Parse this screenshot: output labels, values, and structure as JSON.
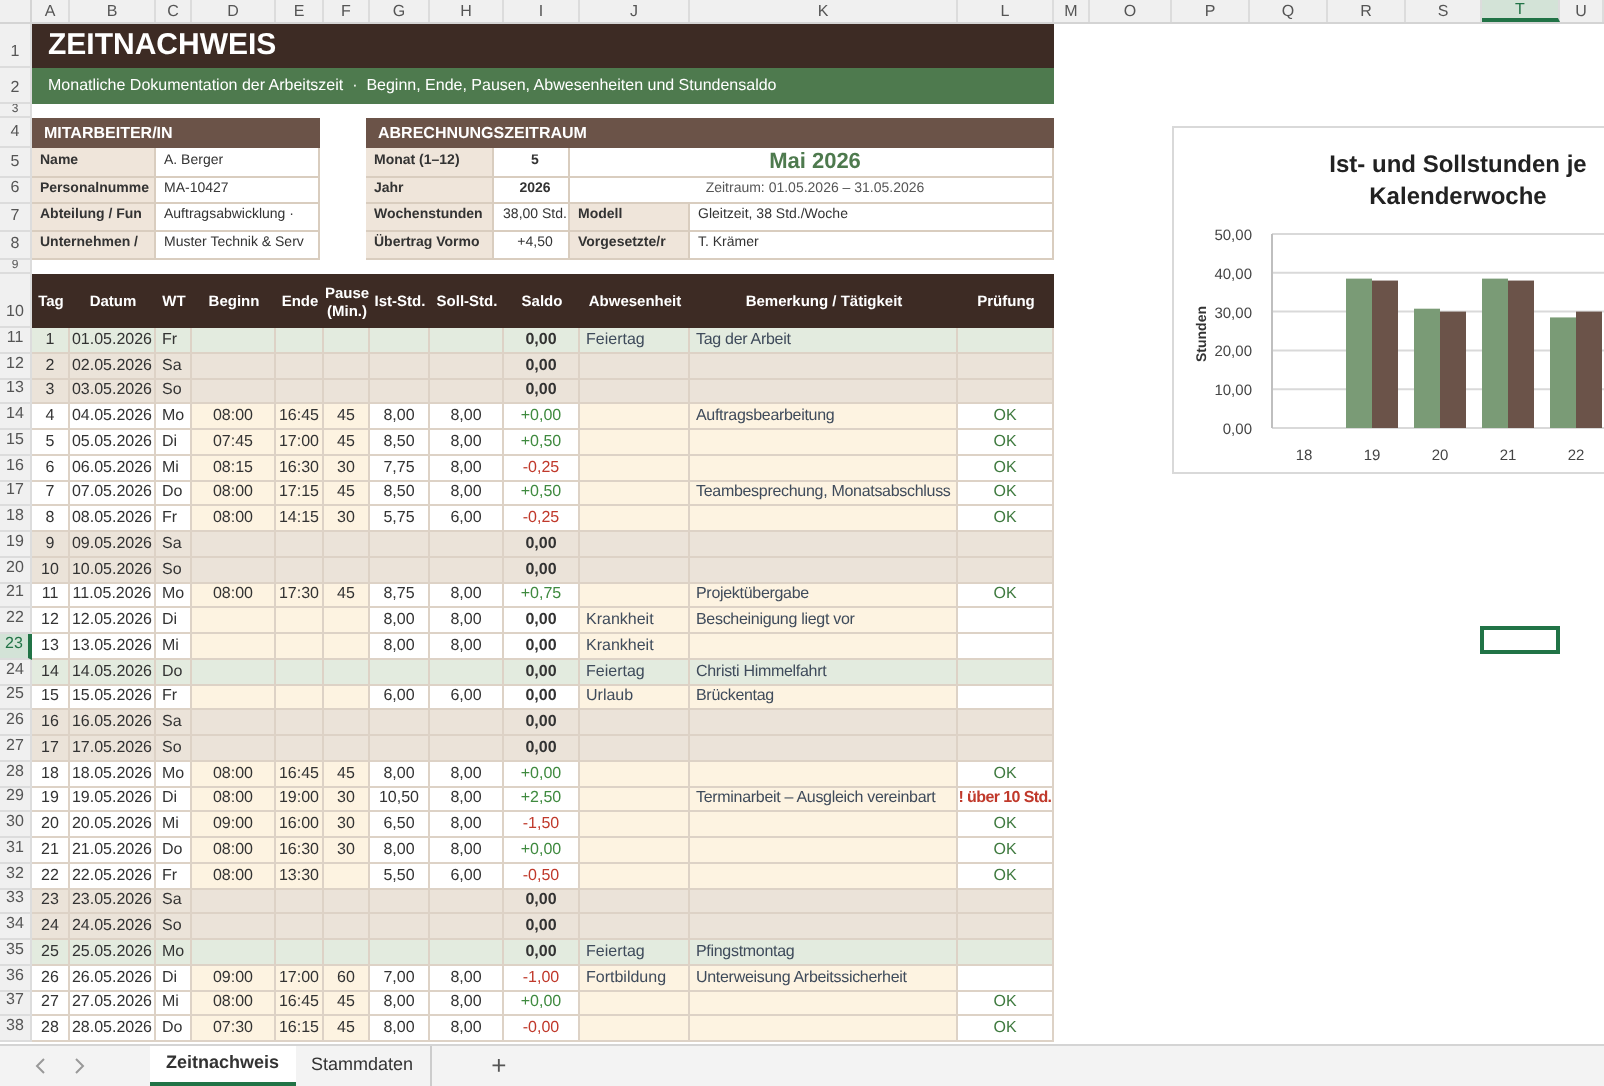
{
  "column_headers": [
    {
      "label": "A",
      "selected": false
    },
    {
      "label": "B",
      "selected": false
    },
    {
      "label": "C",
      "selected": false
    },
    {
      "label": "D",
      "selected": false
    },
    {
      "label": "E",
      "selected": false
    },
    {
      "label": "F",
      "selected": false
    },
    {
      "label": "G",
      "selected": false
    },
    {
      "label": "H",
      "selected": false
    },
    {
      "label": "I",
      "selected": false
    },
    {
      "label": "J",
      "selected": false
    },
    {
      "label": "K",
      "selected": false
    },
    {
      "label": "L",
      "selected": false
    },
    {
      "label": "M",
      "selected": false
    },
    {
      "label": "O",
      "selected": false
    },
    {
      "label": "P",
      "selected": false
    },
    {
      "label": "Q",
      "selected": false
    },
    {
      "label": "R",
      "selected": false
    },
    {
      "label": "S",
      "selected": false
    },
    {
      "label": "T",
      "selected": true
    },
    {
      "label": "U",
      "selected": false
    }
  ],
  "row_headers": [
    {
      "label": "1",
      "selected": false
    },
    {
      "label": "2",
      "selected": false
    },
    {
      "label": "3",
      "selected": false
    },
    {
      "label": "4",
      "selected": false
    },
    {
      "label": "5",
      "selected": false
    },
    {
      "label": "6",
      "selected": false
    },
    {
      "label": "7",
      "selected": false
    },
    {
      "label": "8",
      "selected": false
    },
    {
      "label": "9",
      "selected": false
    },
    {
      "label": "10",
      "selected": false
    },
    {
      "label": "11",
      "selected": false
    },
    {
      "label": "12",
      "selected": false
    },
    {
      "label": "13",
      "selected": false
    },
    {
      "label": "14",
      "selected": false
    },
    {
      "label": "15",
      "selected": false
    },
    {
      "label": "16",
      "selected": false
    },
    {
      "label": "17",
      "selected": false
    },
    {
      "label": "18",
      "selected": false
    },
    {
      "label": "19",
      "selected": false
    },
    {
      "label": "20",
      "selected": false
    },
    {
      "label": "21",
      "selected": false
    },
    {
      "label": "22",
      "selected": false
    },
    {
      "label": "23",
      "selected": true
    },
    {
      "label": "24",
      "selected": false
    },
    {
      "label": "25",
      "selected": false
    },
    {
      "label": "26",
      "selected": false
    },
    {
      "label": "27",
      "selected": false
    },
    {
      "label": "28",
      "selected": false
    },
    {
      "label": "29",
      "selected": false
    },
    {
      "label": "30",
      "selected": false
    },
    {
      "label": "31",
      "selected": false
    },
    {
      "label": "32",
      "selected": false
    },
    {
      "label": "33",
      "selected": false
    },
    {
      "label": "34",
      "selected": false
    },
    {
      "label": "35",
      "selected": false
    },
    {
      "label": "36",
      "selected": false
    },
    {
      "label": "37",
      "selected": false
    },
    {
      "label": "38",
      "selected": false
    }
  ],
  "title": "ZEITNACHWEIS",
  "subtitle": "Monatliche Dokumentation der Arbeitszeit  ·  Beginn, Ende, Pausen, Abwesenheiten und Stundensaldo",
  "employee": {
    "heading": "MITARBEITER/IN",
    "fields": [
      {
        "label": "Name",
        "value": "A. Berger"
      },
      {
        "label": "Personalnumme",
        "value": "MA-10427"
      },
      {
        "label": "Abteilung / Fun",
        "value": "Auftragsabwicklung ·"
      },
      {
        "label": "Unternehmen /",
        "value": "Muster Technik & Serv"
      }
    ]
  },
  "period": {
    "heading": "ABRECHNUNGSZEITRAUM",
    "month_label": "Monat (1–12)",
    "month": "5",
    "month_name": "Mai 2026",
    "year_label": "Jahr",
    "year": "2026",
    "range": "Zeitraum: 01.05.2026 – 31.05.2026",
    "weekly_label": "Wochenstunden",
    "weekly": "38,00 Std.",
    "model_label": "Modell",
    "model": "Gleitzeit, 38 Std./Woche",
    "carry_label": "Übertrag Vormo",
    "carry": "+4,50",
    "supervisor_label": "Vorgesetzte/r",
    "supervisor": "T. Krämer"
  },
  "table": {
    "columns": [
      "Tag",
      "Datum",
      "WT",
      "Beginn",
      "Ende",
      "Pause (Min.)",
      "Ist-Std.",
      "Soll-Std.",
      "Saldo",
      "Abwesenheit",
      "Bemerkung / Tätigkeit",
      "Prüfung"
    ],
    "rows": [
      {
        "kind": "holiday",
        "tag": "1",
        "datum": "01.05.2026",
        "wt": "Fr",
        "saldo": {
          "text": "0,00",
          "color": "#333333",
          "bold": true
        },
        "abwesenheit": "Feiertag",
        "bemerkung": "Tag der Arbeit"
      },
      {
        "kind": "weekend",
        "tag": "2",
        "datum": "02.05.2026",
        "wt": "Sa",
        "saldo": {
          "text": "0,00",
          "color": "#333333",
          "bold": true
        }
      },
      {
        "kind": "weekend",
        "tag": "3",
        "datum": "03.05.2026",
        "wt": "So",
        "saldo": {
          "text": "0,00",
          "color": "#333333",
          "bold": true
        }
      },
      {
        "kind": "work",
        "tag": "4",
        "datum": "04.05.2026",
        "wt": "Mo",
        "beginn": "08:00",
        "ende": "16:45",
        "pause": "45",
        "ist": "8,00",
        "soll": "8,00",
        "saldo": {
          "text": "+0,00",
          "color": "#3f8a3f",
          "bold": false
        },
        "bemerkung": "Auftragsbearbeitung",
        "pruefung": {
          "text": "OK",
          "kind": "ok"
        }
      },
      {
        "kind": "work",
        "tag": "5",
        "datum": "05.05.2026",
        "wt": "Di",
        "beginn": "07:45",
        "ende": "17:00",
        "pause": "45",
        "ist": "8,50",
        "soll": "8,00",
        "saldo": {
          "text": "+0,50",
          "color": "#3f8a3f",
          "bold": false
        },
        "pruefung": {
          "text": "OK",
          "kind": "ok"
        }
      },
      {
        "kind": "work",
        "tag": "6",
        "datum": "06.05.2026",
        "wt": "Mi",
        "beginn": "08:15",
        "ende": "16:30",
        "pause": "30",
        "ist": "7,75",
        "soll": "8,00",
        "saldo": {
          "text": "-0,25",
          "color": "#c0392b",
          "bold": false
        },
        "pruefung": {
          "text": "OK",
          "kind": "ok"
        }
      },
      {
        "kind": "work",
        "tag": "7",
        "datum": "07.05.2026",
        "wt": "Do",
        "beginn": "08:00",
        "ende": "17:15",
        "pause": "45",
        "ist": "8,50",
        "soll": "8,00",
        "saldo": {
          "text": "+0,50",
          "color": "#3f8a3f",
          "bold": false
        },
        "bemerkung": "Teambesprechung, Monatsabschluss",
        "pruefung": {
          "text": "OK",
          "kind": "ok"
        }
      },
      {
        "kind": "work",
        "tag": "8",
        "datum": "08.05.2026",
        "wt": "Fr",
        "beginn": "08:00",
        "ende": "14:15",
        "pause": "30",
        "ist": "5,75",
        "soll": "6,00",
        "saldo": {
          "text": "-0,25",
          "color": "#c0392b",
          "bold": false
        },
        "pruefung": {
          "text": "OK",
          "kind": "ok"
        }
      },
      {
        "kind": "weekend",
        "tag": "9",
        "datum": "09.05.2026",
        "wt": "Sa",
        "saldo": {
          "text": "0,00",
          "color": "#333333",
          "bold": true
        }
      },
      {
        "kind": "weekend",
        "tag": "10",
        "datum": "10.05.2026",
        "wt": "So",
        "saldo": {
          "text": "0,00",
          "color": "#333333",
          "bold": true
        }
      },
      {
        "kind": "work",
        "tag": "11",
        "datum": "11.05.2026",
        "wt": "Mo",
        "beginn": "08:00",
        "ende": "17:30",
        "pause": "45",
        "ist": "8,75",
        "soll": "8,00",
        "saldo": {
          "text": "+0,75",
          "color": "#3f8a3f",
          "bold": false
        },
        "bemerkung": "Projektübergabe",
        "pruefung": {
          "text": "OK",
          "kind": "ok"
        }
      },
      {
        "kind": "work",
        "tag": "12",
        "datum": "12.05.2026",
        "wt": "Di",
        "ist": "8,00",
        "soll": "8,00",
        "saldo": {
          "text": "0,00",
          "color": "#333333",
          "bold": true
        },
        "abwesenheit": "Krankheit",
        "bemerkung": "Bescheinigung liegt vor"
      },
      {
        "kind": "work",
        "tag": "13",
        "datum": "13.05.2026",
        "wt": "Mi",
        "ist": "8,00",
        "soll": "8,00",
        "saldo": {
          "text": "0,00",
          "color": "#333333",
          "bold": true
        },
        "abwesenheit": "Krankheit"
      },
      {
        "kind": "holiday",
        "tag": "14",
        "datum": "14.05.2026",
        "wt": "Do",
        "saldo": {
          "text": "0,00",
          "color": "#333333",
          "bold": true
        },
        "abwesenheit": "Feiertag",
        "bemerkung": "Christi Himmelfahrt"
      },
      {
        "kind": "work",
        "tag": "15",
        "datum": "15.05.2026",
        "wt": "Fr",
        "ist": "6,00",
        "soll": "6,00",
        "saldo": {
          "text": "0,00",
          "color": "#333333",
          "bold": true
        },
        "abwesenheit": "Urlaub",
        "bemerkung": "Brückentag"
      },
      {
        "kind": "weekend",
        "tag": "16",
        "datum": "16.05.2026",
        "wt": "Sa",
        "saldo": {
          "text": "0,00",
          "color": "#333333",
          "bold": true
        }
      },
      {
        "kind": "weekend",
        "tag": "17",
        "datum": "17.05.2026",
        "wt": "So",
        "saldo": {
          "text": "0,00",
          "color": "#333333",
          "bold": true
        }
      },
      {
        "kind": "work",
        "tag": "18",
        "datum": "18.05.2026",
        "wt": "Mo",
        "beginn": "08:00",
        "ende": "16:45",
        "pause": "45",
        "ist": "8,00",
        "soll": "8,00",
        "saldo": {
          "text": "+0,00",
          "color": "#3f8a3f",
          "bold": false
        },
        "pruefung": {
          "text": "OK",
          "kind": "ok"
        }
      },
      {
        "kind": "work",
        "tag": "19",
        "datum": "19.05.2026",
        "wt": "Di",
        "beginn": "08:00",
        "ende": "19:00",
        "pause": "30",
        "ist": "10,50",
        "soll": "8,00",
        "saldo": {
          "text": "+2,50",
          "color": "#3f8a3f",
          "bold": false
        },
        "bemerkung": "Terminarbeit – Ausgleich vereinbart",
        "pruefung": {
          "text": "! über 10 Std.",
          "kind": "warning"
        }
      },
      {
        "kind": "work",
        "tag": "20",
        "datum": "20.05.2026",
        "wt": "Mi",
        "beginn": "09:00",
        "ende": "16:00",
        "pause": "30",
        "ist": "6,50",
        "soll": "8,00",
        "saldo": {
          "text": "-1,50",
          "color": "#c0392b",
          "bold": false
        },
        "pruefung": {
          "text": "OK",
          "kind": "ok"
        }
      },
      {
        "kind": "work",
        "tag": "21",
        "datum": "21.05.2026",
        "wt": "Do",
        "beginn": "08:00",
        "ende": "16:30",
        "pause": "30",
        "ist": "8,00",
        "soll": "8,00",
        "saldo": {
          "text": "+0,00",
          "color": "#3f8a3f",
          "bold": false
        },
        "pruefung": {
          "text": "OK",
          "kind": "ok"
        }
      },
      {
        "kind": "work",
        "tag": "22",
        "datum": "22.05.2026",
        "wt": "Fr",
        "beginn": "08:00",
        "ende": "13:30",
        "ist": "5,50",
        "soll": "6,00",
        "saldo": {
          "text": "-0,50",
          "color": "#c0392b",
          "bold": false
        },
        "pruefung": {
          "text": "OK",
          "kind": "ok"
        }
      },
      {
        "kind": "weekend",
        "tag": "23",
        "datum": "23.05.2026",
        "wt": "Sa",
        "saldo": {
          "text": "0,00",
          "color": "#333333",
          "bold": true
        }
      },
      {
        "kind": "weekend",
        "tag": "24",
        "datum": "24.05.2026",
        "wt": "So",
        "saldo": {
          "text": "0,00",
          "color": "#333333",
          "bold": true
        }
      },
      {
        "kind": "holiday",
        "tag": "25",
        "datum": "25.05.2026",
        "wt": "Mo",
        "saldo": {
          "text": "0,00",
          "color": "#333333",
          "bold": true
        },
        "abwesenheit": "Feiertag",
        "bemerkung": "Pfingstmontag"
      },
      {
        "kind": "work",
        "tag": "26",
        "datum": "26.05.2026",
        "wt": "Di",
        "beginn": "09:00",
        "ende": "17:00",
        "pause": "60",
        "ist": "7,00",
        "soll": "8,00",
        "saldo": {
          "text": "-1,00",
          "color": "#c0392b",
          "bold": false
        },
        "abwesenheit": "Fortbildung",
        "bemerkung": "Unterweisung Arbeitssicherheit"
      },
      {
        "kind": "work",
        "tag": "27",
        "datum": "27.05.2026",
        "wt": "Mi",
        "beginn": "08:00",
        "ende": "16:45",
        "pause": "45",
        "ist": "8,00",
        "soll": "8,00",
        "saldo": {
          "text": "+0,00",
          "color": "#3f8a3f",
          "bold": false
        },
        "pruefung": {
          "text": "OK",
          "kind": "ok"
        }
      },
      {
        "kind": "work",
        "tag": "28",
        "datum": "28.05.2026",
        "wt": "Do",
        "beginn": "07:30",
        "ende": "16:15",
        "pause": "45",
        "ist": "8,00",
        "soll": "8,00",
        "saldo": {
          "text": "-0,00",
          "color": "#c0392b",
          "bold": false
        },
        "pruefung": {
          "text": "OK",
          "kind": "ok"
        }
      }
    ]
  },
  "chart": {
    "chart_data": {
      "type": "bar",
      "grid": true,
      "title": "Ist- und Sollstunden je Kalenderwoche",
      "ylabel": "Stunden",
      "categories": [
        "18",
        "19",
        "20",
        "21",
        "22"
      ],
      "series": [
        {
          "color": "#7a9b76",
          "values": [
            0,
            38.5,
            30.75,
            38.5,
            28.5
          ]
        },
        {
          "color": "#6b5349",
          "values": [
            0,
            38,
            30,
            38,
            30
          ]
        }
      ],
      "ylim": [
        0,
        50
      ],
      "yticks": [
        {
          "value": 0,
          "label": "0,00"
        },
        {
          "value": 10,
          "label": "10,00"
        },
        {
          "value": 20,
          "label": "20,00"
        },
        {
          "value": 30,
          "label": "30,00"
        },
        {
          "value": 40,
          "label": "40,00"
        },
        {
          "value": 50,
          "label": "50,00"
        }
      ]
    }
  },
  "sheet_tabs": [
    {
      "label": "Zeitnachweis",
      "selected": true
    },
    {
      "label": "Stammdaten",
      "selected": false
    }
  ],
  "add_sheet": "+"
}
